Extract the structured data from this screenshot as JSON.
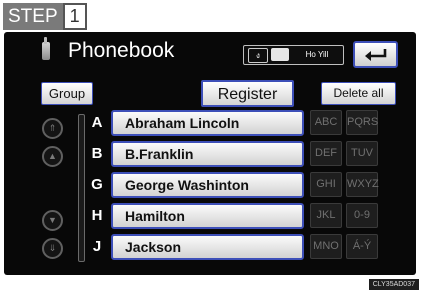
{
  "step": {
    "label": "STEP",
    "number": "1"
  },
  "screen": {
    "title": "Phonebook",
    "status": {
      "bt": "ง",
      "battery": "",
      "signal": "Ho Yill"
    },
    "group_label": "Group",
    "register_label": "Register",
    "delete_all_label": "Delete all",
    "contacts": [
      {
        "letter": "A",
        "name": "Abraham Lincoln"
      },
      {
        "letter": "B",
        "name": "B.Franklin"
      },
      {
        "letter": "G",
        "name": "George Washinton"
      },
      {
        "letter": "H",
        "name": "Hamilton"
      },
      {
        "letter": "J",
        "name": "Jackson"
      }
    ],
    "keys_left": [
      "ABC",
      "DEF",
      "GHI",
      "JKL",
      "MNO"
    ],
    "keys_right": [
      "PQRS",
      "TUV",
      "WXYZ",
      "0-9",
      "Á-Ý"
    ]
  },
  "image_code": "CLY35AD037",
  "colors": {
    "accent_border": "#3d4fb8",
    "screen_bg": "#080808",
    "step_bg": "#7a7a7a"
  }
}
